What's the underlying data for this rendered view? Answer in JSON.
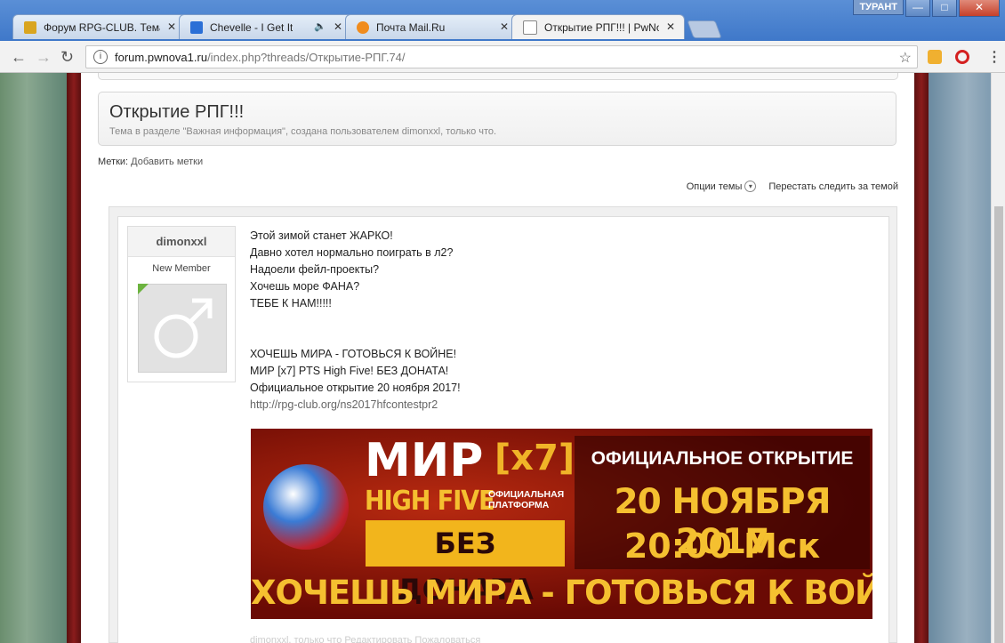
{
  "browser": {
    "tabs": [
      {
        "label": "Форум RPG-CLUB. Тема",
        "favicon_color": "#d9a520",
        "active": false,
        "audio": false
      },
      {
        "label": "Chevelle - I Get It",
        "favicon_color": "#2a6fd6",
        "active": false,
        "audio": true
      },
      {
        "label": "Почта Mail.Ru",
        "favicon_color": "#f08c1e",
        "active": false,
        "audio": false
      },
      {
        "label": "Открытие РПГ!!! | PwNo",
        "favicon_color": "#ffffff",
        "active": true,
        "audio": false
      }
    ],
    "close_glyph": "✕",
    "sound_glyph": "🔈",
    "user_badge": "ТУРАНТ",
    "window_buttons": {
      "minimize": "—",
      "maximize": "□",
      "close": "✕"
    },
    "url_host": "forum.pwnova1.ru",
    "url_path": "/index.php?threads/Открытие-РПГ.74/",
    "nav": {
      "back": "←",
      "forward": "→",
      "reload": "↻",
      "info": "i",
      "star": "☆",
      "menu": "⋮"
    }
  },
  "thread": {
    "title": "Открытие РПГ!!!",
    "description": "Тема в разделе \"Важная информация\", создана пользователем dimonxxl, только что.",
    "tags_label": "Метки:",
    "add_tags": "Добавить метки",
    "options": "Опции темы",
    "options_arrow": "▾",
    "unwatch": "Перестать следить за темой"
  },
  "post": {
    "username": "dimonxxl",
    "user_title": "New Member",
    "avatar_glyph": "♂",
    "lines": [
      "Этой зимой станет ЖАРКО!",
      "Давно хотел нормально поиграть в л2?",
      "Надоели фейл-проекты?",
      "Хочешь море ФАНА?",
      "ТЕБЕ К НАМ!!!!!",
      "",
      "",
      "ХОЧЕШЬ МИРА - ГОТОВЬСЯ К ВОЙНЕ!",
      "МИР [x7] PTS High Five! БЕЗ ДОНАТА!",
      "Официальное открытие 20 ноября 2017!"
    ],
    "link": "http://rpg-club.org/ns2017hfcontestpr2",
    "footer": "dimonxxl, только что   Редактировать   Пожаловаться"
  },
  "banner": {
    "mir": "МИР",
    "x7": "[x7]",
    "high_five": "HIGH FIVE",
    "platform": "ОФИЦИАЛЬНАЯ ПЛАТФОРМА",
    "no_donate": "БЕЗ ДОНАТА",
    "official_opening": "ОФИЦИАЛЬНОЕ ОТКРЫТИЕ",
    "date": "20 НОЯБРЯ 2017",
    "time": "20:00 Мск",
    "slogan": "ХОЧЕШЬ МИРА - ГОТОВЬСЯ К ВОЙНЕ"
  }
}
